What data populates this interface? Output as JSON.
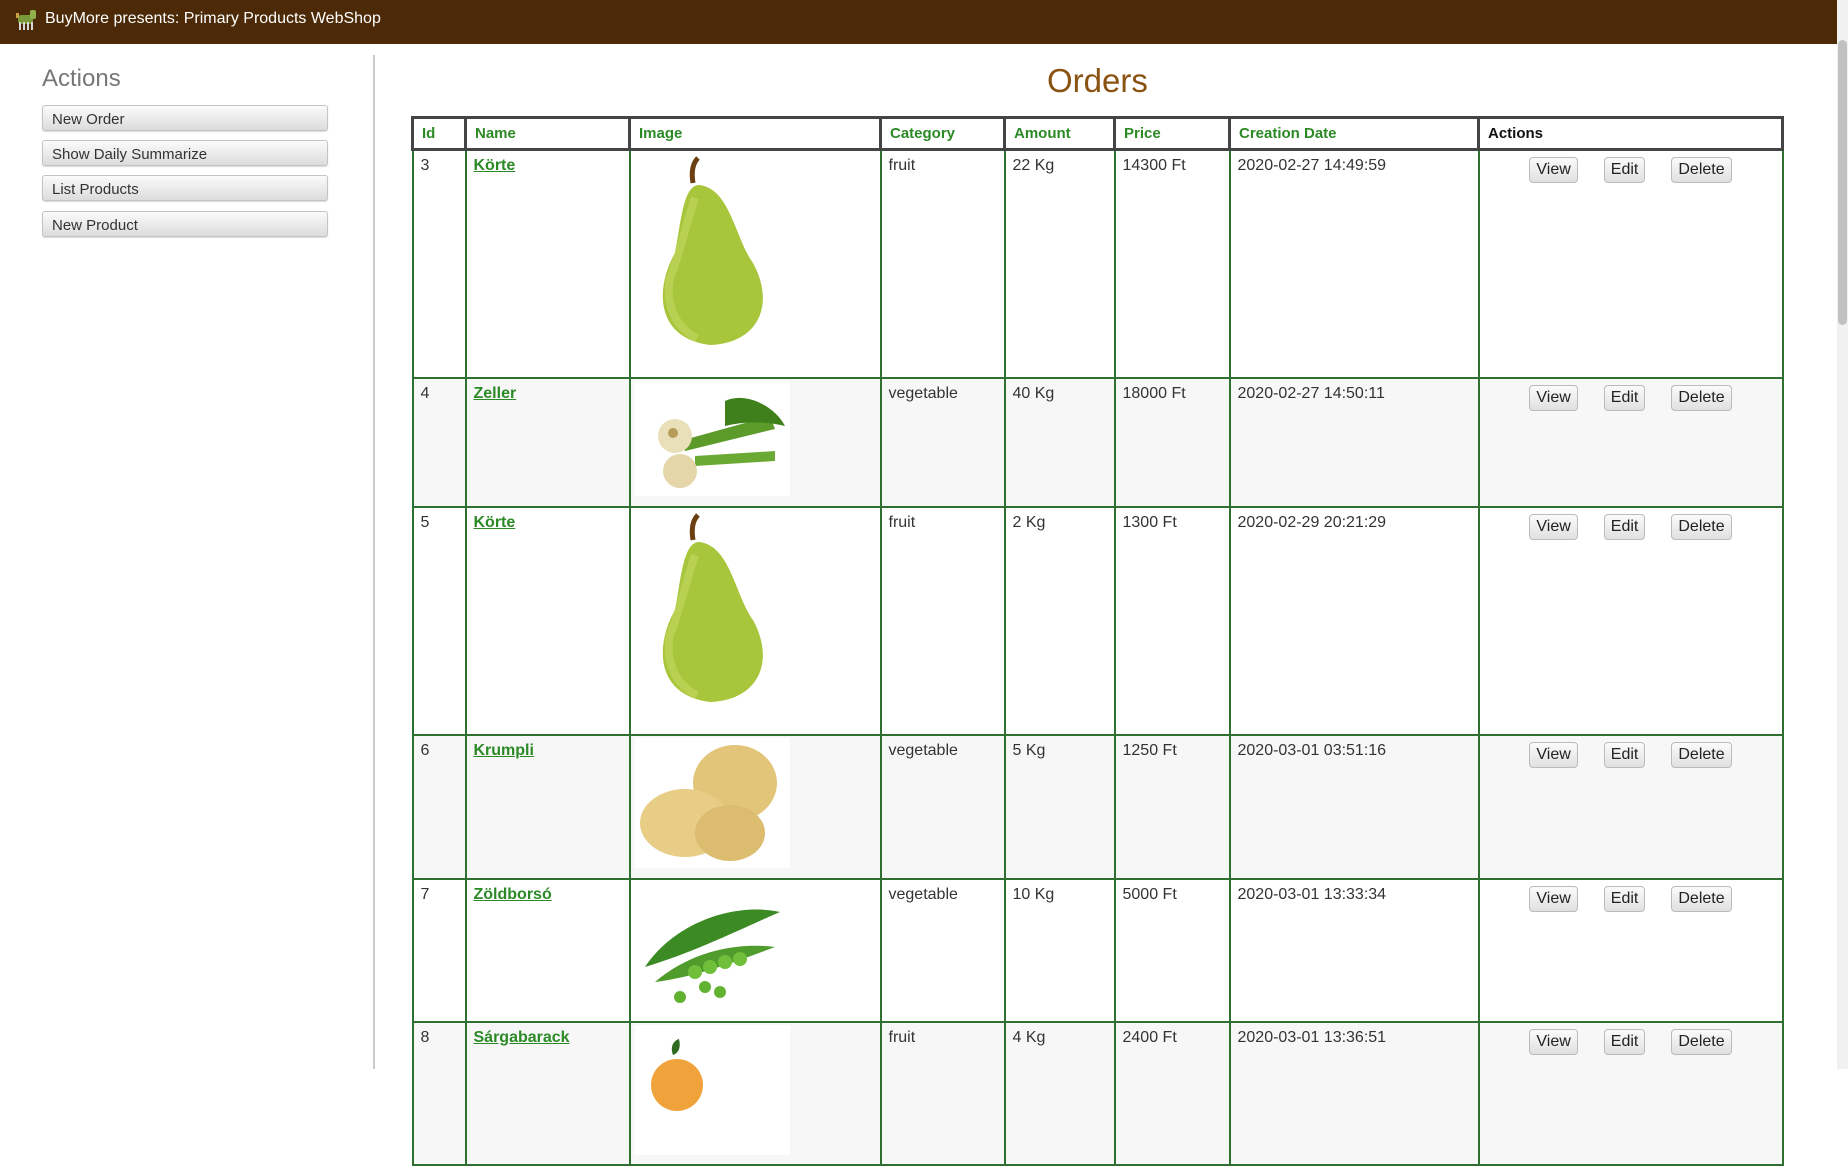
{
  "app": {
    "title": "BuyMore presents: Primary Products WebShop",
    "logo_icon": "farm-animal-logo-icon"
  },
  "sidebar": {
    "heading": "Actions",
    "buttons": [
      "New Order",
      "Show Daily Summarize",
      "List Products",
      "New Product"
    ]
  },
  "main": {
    "title": "Orders",
    "columns": [
      "Id",
      "Name",
      "Image",
      "Category",
      "Amount",
      "Price",
      "Creation Date",
      "Actions"
    ],
    "action_labels": {
      "view": "View",
      "edit": "Edit",
      "delete": "Delete"
    },
    "rows": [
      {
        "id": "3",
        "name": "Körte",
        "image": "pear-image",
        "category": "fruit",
        "amount": "22 Kg",
        "price": "14300 Ft",
        "created": "2020-02-27 14:49:59"
      },
      {
        "id": "4",
        "name": "Zeller",
        "image": "celery-image",
        "category": "vegetable",
        "amount": "40 Kg",
        "price": "18000 Ft",
        "created": "2020-02-27 14:50:11"
      },
      {
        "id": "5",
        "name": "Körte",
        "image": "pear-image",
        "category": "fruit",
        "amount": "2 Kg",
        "price": "1300 Ft",
        "created": "2020-02-29 20:21:29"
      },
      {
        "id": "6",
        "name": "Krumpli",
        "image": "potato-image",
        "category": "vegetable",
        "amount": "5 Kg",
        "price": "1250 Ft",
        "created": "2020-03-01 03:51:16"
      },
      {
        "id": "7",
        "name": "Zöldborsó",
        "image": "peas-image",
        "category": "vegetable",
        "amount": "10 Kg",
        "price": "5000 Ft",
        "created": "2020-03-01 13:33:34"
      },
      {
        "id": "8",
        "name": "Sárgabarack",
        "image": "apricot-image",
        "category": "fruit",
        "amount": "4 Kg",
        "price": "2400 Ft",
        "created": "2020-03-01 13:36:51"
      }
    ]
  },
  "colors": {
    "topbar": "#4c2a07",
    "title": "#8a5211",
    "link": "#2c8a26",
    "border": "#2f6f2f"
  }
}
